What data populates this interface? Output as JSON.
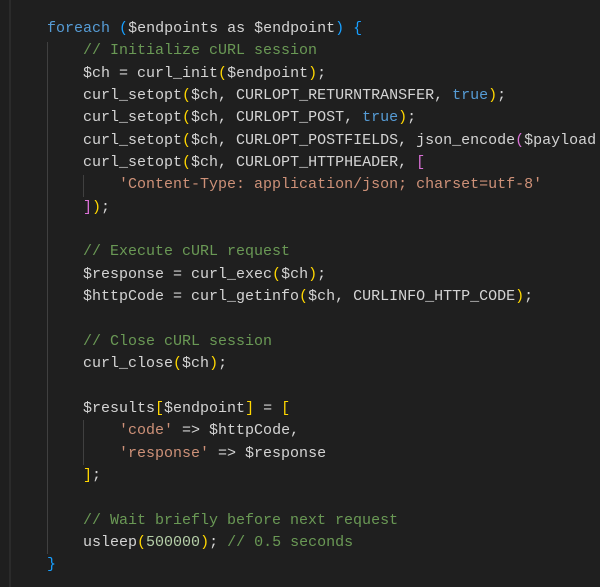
{
  "editor": {
    "lines": [
      [
        [
          "pl",
          "    "
        ],
        [
          "kw",
          "foreach"
        ],
        [
          "pl",
          " "
        ],
        [
          "b3",
          "("
        ],
        [
          "pl",
          "$endpoints as $endpoint"
        ],
        [
          "b3",
          ")"
        ],
        [
          "pl",
          " "
        ],
        [
          "b3",
          "{"
        ]
      ],
      [
        [
          "pl",
          "        "
        ],
        [
          "cm",
          "// Initialize cURL session"
        ]
      ],
      [
        [
          "pl",
          "        $ch = curl_init"
        ],
        [
          "b1",
          "("
        ],
        [
          "pl",
          "$endpoint"
        ],
        [
          "b1",
          ")"
        ],
        [
          "pl",
          ";"
        ]
      ],
      [
        [
          "pl",
          "        curl_setopt"
        ],
        [
          "b1",
          "("
        ],
        [
          "pl",
          "$ch, CURLOPT_RETURNTRANSFER, "
        ],
        [
          "kw",
          "true"
        ],
        [
          "b1",
          ")"
        ],
        [
          "pl",
          ";"
        ]
      ],
      [
        [
          "pl",
          "        curl_setopt"
        ],
        [
          "b1",
          "("
        ],
        [
          "pl",
          "$ch, CURLOPT_POST, "
        ],
        [
          "kw",
          "true"
        ],
        [
          "b1",
          ")"
        ],
        [
          "pl",
          ";"
        ]
      ],
      [
        [
          "pl",
          "        curl_setopt"
        ],
        [
          "b1",
          "("
        ],
        [
          "pl",
          "$ch, CURLOPT_POSTFIELDS, json_encode"
        ],
        [
          "b2",
          "("
        ],
        [
          "pl",
          "$payload"
        ]
      ],
      [
        [
          "pl",
          "        curl_setopt"
        ],
        [
          "b1",
          "("
        ],
        [
          "pl",
          "$ch, CURLOPT_HTTPHEADER, "
        ],
        [
          "b2",
          "["
        ]
      ],
      [
        [
          "pl",
          "            "
        ],
        [
          "st",
          "'Content-Type: application/json; charset=utf-8'"
        ]
      ],
      [
        [
          "pl",
          "        "
        ],
        [
          "b2",
          "]"
        ],
        [
          "b1",
          ")"
        ],
        [
          "pl",
          ";"
        ]
      ],
      [
        [
          "pl",
          ""
        ]
      ],
      [
        [
          "pl",
          "        "
        ],
        [
          "cm",
          "// Execute cURL request"
        ]
      ],
      [
        [
          "pl",
          "        $response = curl_exec"
        ],
        [
          "b1",
          "("
        ],
        [
          "pl",
          "$ch"
        ],
        [
          "b1",
          ")"
        ],
        [
          "pl",
          ";"
        ]
      ],
      [
        [
          "pl",
          "        $httpCode = curl_getinfo"
        ],
        [
          "b1",
          "("
        ],
        [
          "pl",
          "$ch, CURLINFO_HTTP_CODE"
        ],
        [
          "b1",
          ")"
        ],
        [
          "pl",
          ";"
        ]
      ],
      [
        [
          "pl",
          ""
        ]
      ],
      [
        [
          "pl",
          "        "
        ],
        [
          "cm",
          "// Close cURL session"
        ]
      ],
      [
        [
          "pl",
          "        curl_close"
        ],
        [
          "b1",
          "("
        ],
        [
          "pl",
          "$ch"
        ],
        [
          "b1",
          ")"
        ],
        [
          "pl",
          ";"
        ]
      ],
      [
        [
          "pl",
          ""
        ]
      ],
      [
        [
          "pl",
          "        $results"
        ],
        [
          "b1",
          "["
        ],
        [
          "pl",
          "$endpoint"
        ],
        [
          "b1",
          "]"
        ],
        [
          "pl",
          " = "
        ],
        [
          "b1",
          "["
        ]
      ],
      [
        [
          "pl",
          "            "
        ],
        [
          "st",
          "'code'"
        ],
        [
          "pl",
          " => $httpCode,"
        ]
      ],
      [
        [
          "pl",
          "            "
        ],
        [
          "st",
          "'response'"
        ],
        [
          "pl",
          " => $response"
        ]
      ],
      [
        [
          "pl",
          "        "
        ],
        [
          "b1",
          "]"
        ],
        [
          "pl",
          ";"
        ]
      ],
      [
        [
          "pl",
          ""
        ]
      ],
      [
        [
          "pl",
          "        "
        ],
        [
          "cm",
          "// Wait briefly before next request"
        ]
      ],
      [
        [
          "pl",
          "        usleep"
        ],
        [
          "b1",
          "("
        ],
        [
          "nm",
          "500000"
        ],
        [
          "b1",
          ")"
        ],
        [
          "pl",
          "; "
        ],
        [
          "cm",
          "// 0.5 seconds"
        ]
      ],
      [
        [
          "pl",
          "    "
        ],
        [
          "b3",
          "}"
        ]
      ]
    ]
  }
}
